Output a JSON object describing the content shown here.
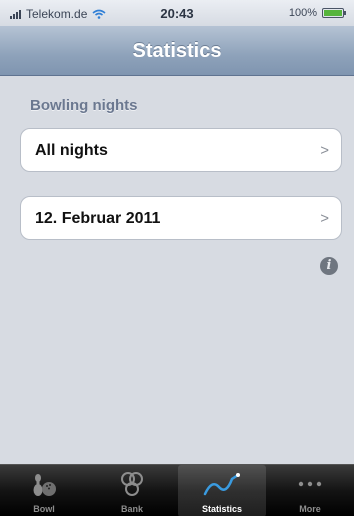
{
  "status_bar": {
    "carrier": "Telekom.de",
    "time": "20:43",
    "battery_text": "100%",
    "battery_level": 1.0
  },
  "nav": {
    "title": "Statistics"
  },
  "section": {
    "header": "Bowling nights"
  },
  "cells": [
    {
      "label": "All nights",
      "chevron": ">"
    },
    {
      "label": "12. Februar 2011",
      "chevron": ">"
    }
  ],
  "info_button": {
    "glyph": "i"
  },
  "tab_bar": {
    "tabs": [
      {
        "label": "Bowl",
        "icon": "bowling-pins-icon",
        "selected": false
      },
      {
        "label": "Bank",
        "icon": "coins-icon",
        "selected": false
      },
      {
        "label": "Statistics",
        "icon": "line-graph-icon",
        "selected": true
      },
      {
        "label": "More",
        "icon": "more-dots-icon",
        "selected": false
      }
    ]
  },
  "colors": {
    "nav_bar": "#8ea2ba",
    "background": "#d7dbe2",
    "section_header": "#6b7890",
    "tab_bar": "#141414",
    "battery_fill": "#55b43c"
  }
}
